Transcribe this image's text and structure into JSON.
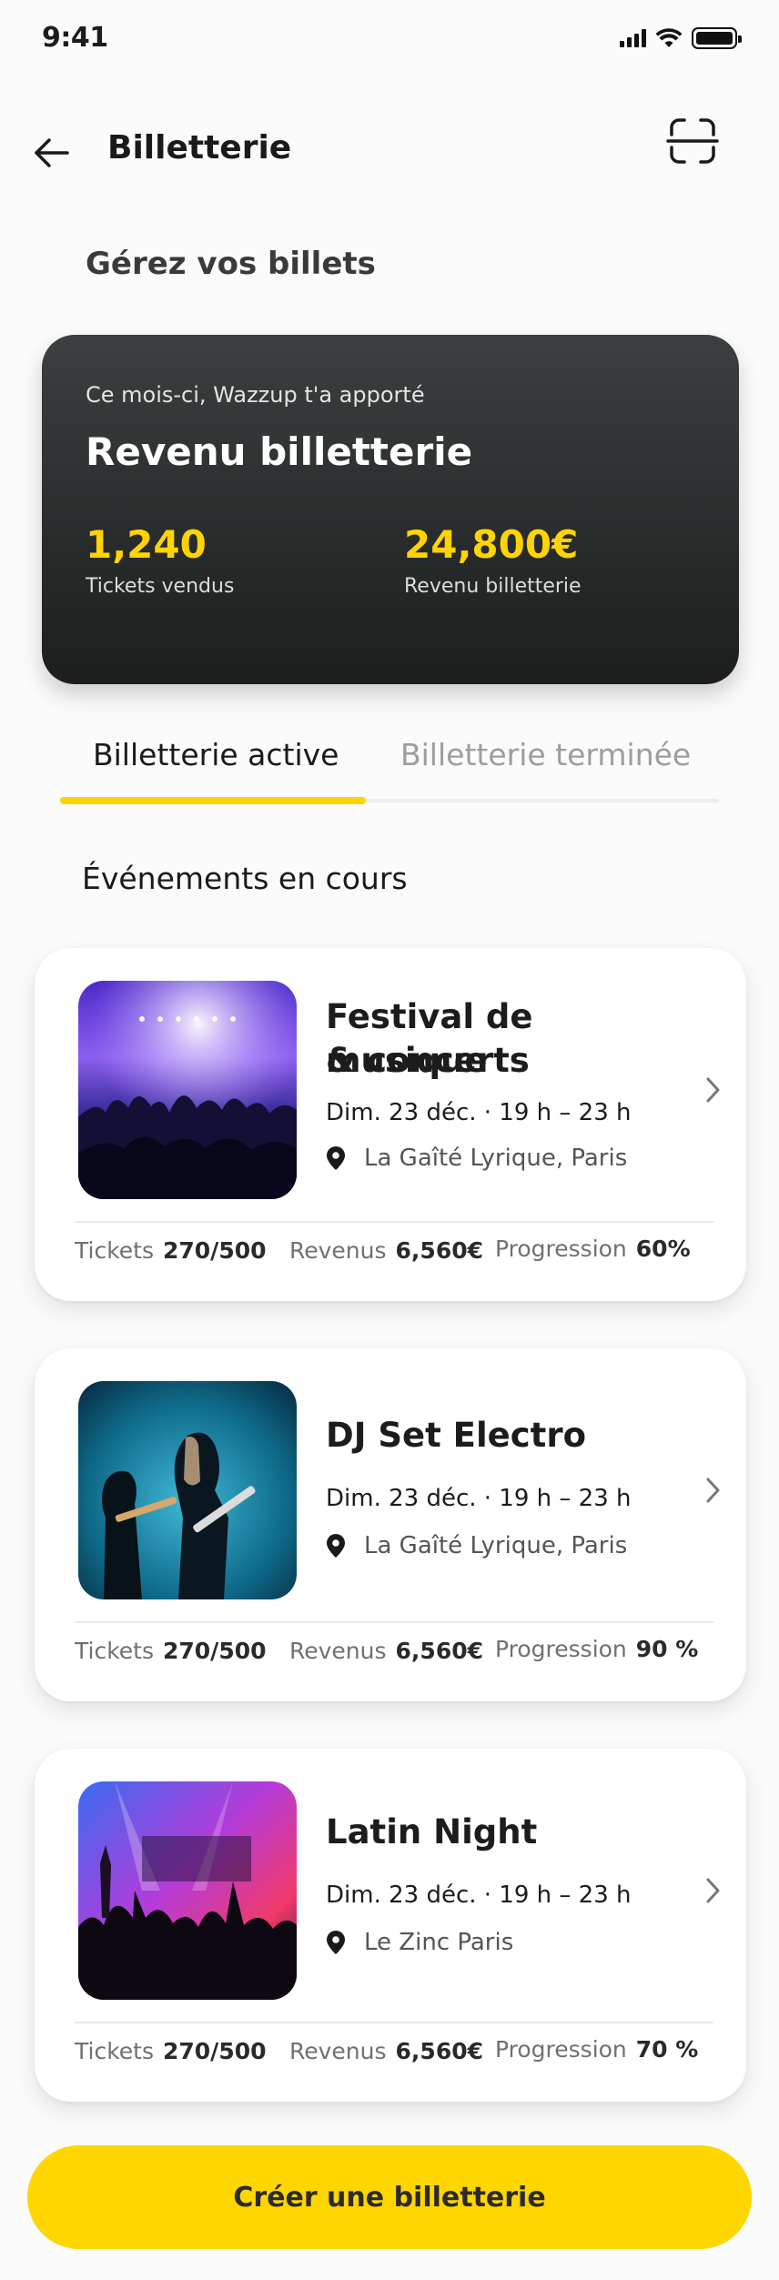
{
  "status_bar": {
    "time": "9:41"
  },
  "header": {
    "title": "Billetterie"
  },
  "section_heading": "Gérez vos billets",
  "revenue_card": {
    "subtitle": "Ce mois-ci, Wazzup t'a apporté",
    "title": "Revenu billetterie",
    "tickets_value": "1,240",
    "tickets_label": "Tickets vendus",
    "revenue_value": "24,800€",
    "revenue_label": "Revenu billetterie"
  },
  "tabs": [
    {
      "label": "Billetterie active",
      "active": true
    },
    {
      "label": "Billetterie terminée",
      "active": false
    }
  ],
  "events_heading": "Événements en cours",
  "events": [
    {
      "title_line1": "Festival de musique",
      "title_line2": "& concerts",
      "date": "Dim. 23 déc. · 19 h – 23 h",
      "location": "La Gaîté Lyrique, Paris",
      "tickets_label": "Tickets",
      "tickets_value": "270/500",
      "revenue_label": "Revenus",
      "revenue_value": "6,560€",
      "progress_label": "Progression",
      "progress_value": "60%"
    },
    {
      "title_line1": "DJ Set Electro",
      "title_line2": "",
      "date": "Dim. 23 déc. · 19 h – 23 h",
      "location": "La Gaîté Lyrique, Paris",
      "tickets_label": "Tickets",
      "tickets_value": "270/500",
      "revenue_label": "Revenus",
      "revenue_value": "6,560€",
      "progress_label": "Progression",
      "progress_value": "90 %"
    },
    {
      "title_line1": "Latin Night",
      "title_line2": "",
      "date": "Dim. 23 déc. · 19 h – 23 h",
      "location": "Le Zinc Paris",
      "tickets_label": "Tickets",
      "tickets_value": "270/500",
      "revenue_label": "Revenus",
      "revenue_value": "6,560€",
      "progress_label": "Progression",
      "progress_value": "70 %"
    }
  ],
  "cta": {
    "label": "Créer une billetterie"
  },
  "colors": {
    "accent": "#ffd400",
    "card_dark": "#2a2d2d"
  }
}
